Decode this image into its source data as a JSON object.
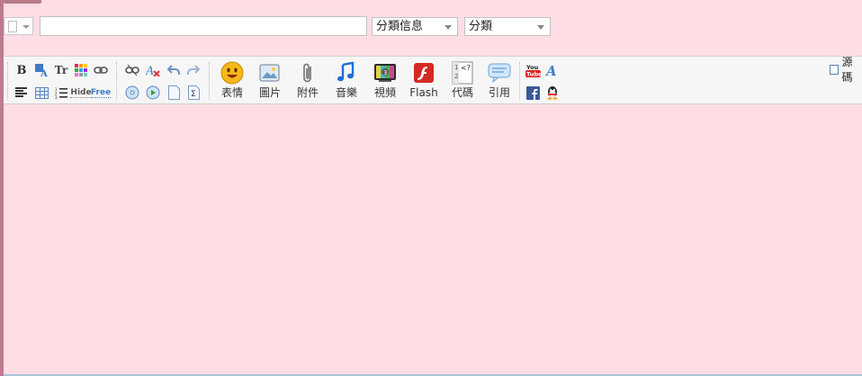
{
  "form": {
    "subject_value": "",
    "category_info": "分類信息",
    "category": "分類"
  },
  "toolbar": {
    "big_buttons": [
      {
        "id": "emoticon",
        "label": "表情",
        "icon": "smiley-icon"
      },
      {
        "id": "image",
        "label": "圖片",
        "icon": "picture-icon"
      },
      {
        "id": "attachment",
        "label": "附件",
        "icon": "paperclip-icon"
      },
      {
        "id": "music",
        "label": "音樂",
        "icon": "music-note-icon"
      },
      {
        "id": "video",
        "label": "視頻",
        "icon": "tv-icon"
      },
      {
        "id": "flash",
        "label": "Flash",
        "icon": "flash-icon"
      },
      {
        "id": "code",
        "label": "代碼",
        "icon": "code-icon"
      },
      {
        "id": "quote",
        "label": "引用",
        "icon": "speech-bubble-icon"
      }
    ],
    "small_labels": {
      "hide": "Hide",
      "free": "Free",
      "bold": "B",
      "font": "Tr"
    },
    "source_label": "源碼"
  },
  "colors": {
    "page_bg": "#ffdde5",
    "toolbar_bg": "#f6f6f6",
    "accent_blue": "#3e7cc6"
  }
}
